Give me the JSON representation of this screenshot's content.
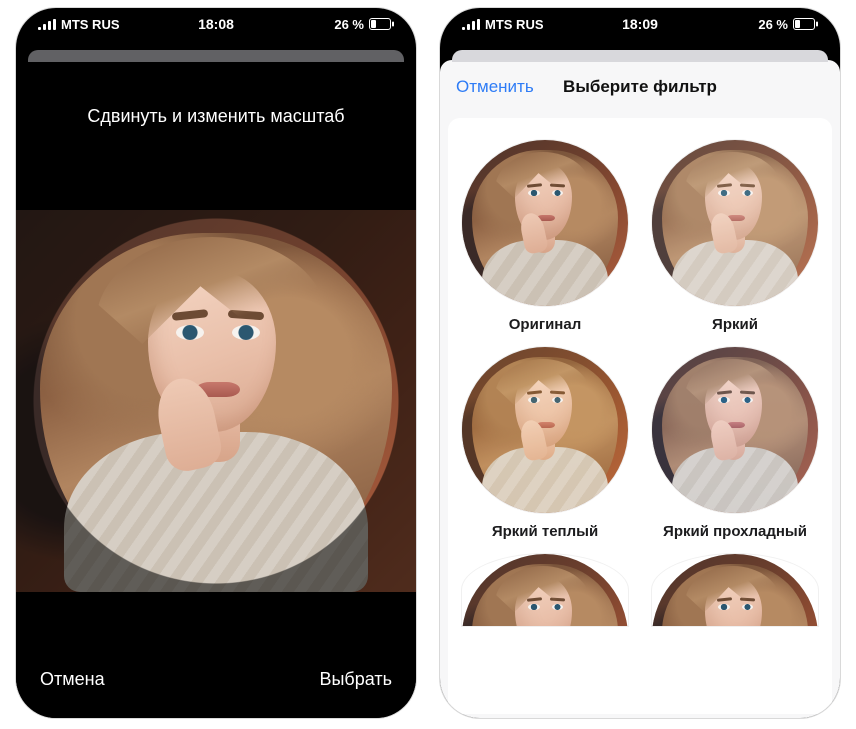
{
  "left": {
    "status": {
      "carrier": "MTS RUS",
      "time": "18:08",
      "battery": "26 %"
    },
    "title": "Сдвинуть и изменить масштаб",
    "cancel": "Отмена",
    "choose": "Выбрать"
  },
  "right": {
    "status": {
      "carrier": "MTS RUS",
      "time": "18:09",
      "battery": "26 %"
    },
    "header": {
      "cancel": "Отменить",
      "title": "Выберите фильтр"
    },
    "filters": [
      {
        "id": "original",
        "label": "Оригинал"
      },
      {
        "id": "bright",
        "label": "Яркий"
      },
      {
        "id": "warm",
        "label": "Яркий теплый"
      },
      {
        "id": "cool",
        "label": "Яркий прохладный"
      }
    ]
  }
}
